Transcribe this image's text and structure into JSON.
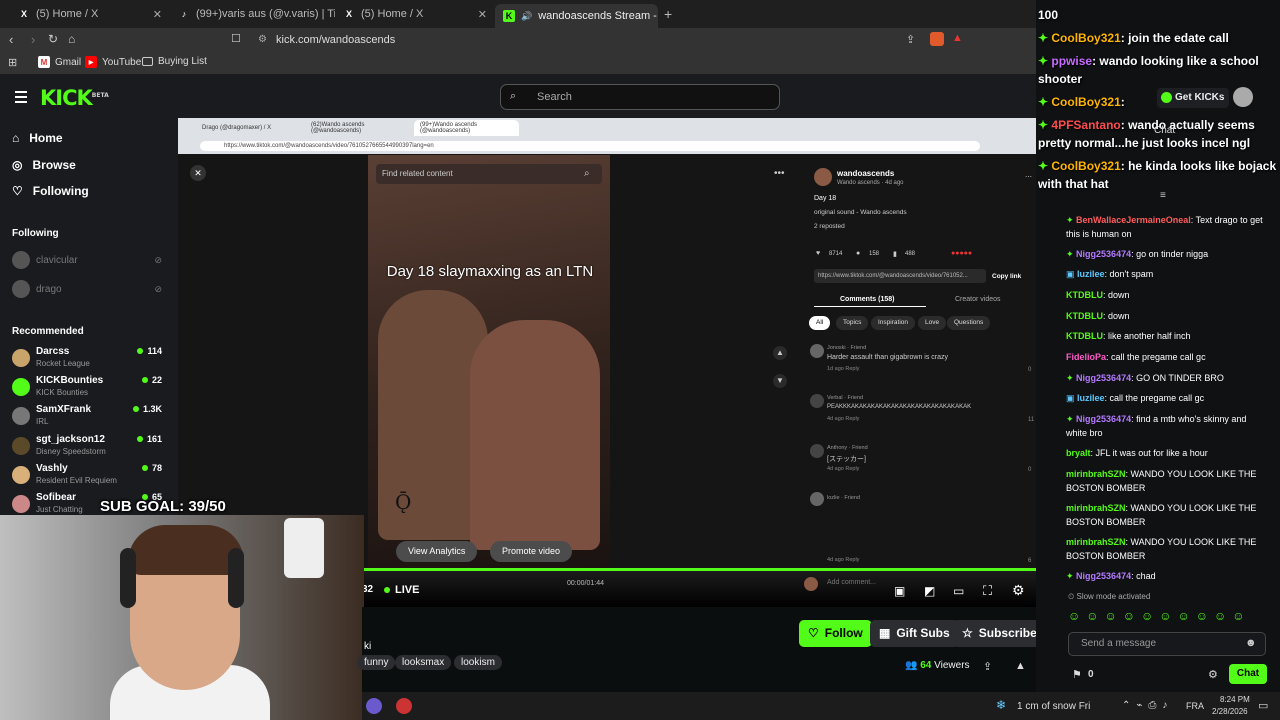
{
  "browser": {
    "tabs": [
      {
        "label": "(5) Home / X",
        "icon": "x-icon"
      },
      {
        "label": "(99+)varis aus (@v.varis) | TikTok",
        "icon": "tiktok-icon"
      },
      {
        "label": "(5) Home / X",
        "icon": "x-icon"
      },
      {
        "label": "wandoascends Stream - Wat",
        "icon": "kick-icon",
        "active": true
      }
    ],
    "url": "kick.com/wandoascends",
    "bookmarks": [
      "Gmail",
      "YouTube",
      "Buying List"
    ]
  },
  "kick": {
    "logo": "KICK",
    "logo_sup": "BETA",
    "search_placeholder": "Search",
    "nav": [
      "Home",
      "Browse",
      "Following"
    ],
    "following_title": "Following",
    "following": [
      "clavicular",
      "drago"
    ],
    "recommended_title": "Recommended",
    "recommended": [
      {
        "name": "Darcss",
        "category": "Rocket League",
        "viewers": "114"
      },
      {
        "name": "KICKBounties",
        "category": "KICK Bounties",
        "viewers": "22"
      },
      {
        "name": "SamXFrank",
        "category": "IRL",
        "viewers": "1.3K"
      },
      {
        "name": "sgt_jackson12",
        "category": "Disney Speedstorm",
        "viewers": "161"
      },
      {
        "name": "Vashly",
        "category": "Resident Evil Requiem",
        "viewers": "78"
      },
      {
        "name": "Sofibear",
        "category": "Just Chatting",
        "viewers": "65"
      }
    ]
  },
  "inner_browser": {
    "tabs": [
      "Drago (@dragomaxer) / X",
      "(62)Wando ascends (@wandoascends)",
      "(99+)Wando ascends (@wandoascends)"
    ],
    "url": "https://www.tiktok.com/@wandoascends/video/7610527665544990397lang=en"
  },
  "tiktok": {
    "find_related": "Find related content",
    "caption": "Day 18 slaymaxxing as an LTN",
    "watermark": "Ǭ",
    "view_analytics": "View Analytics",
    "promote_video": "Promote video",
    "time": "00:00/01:44",
    "author": "wandoascends",
    "author_sub": "Wando ascends · 4d ago",
    "post_title": "Day 18",
    "sound": "original sound - Wando ascends",
    "reposted": "2 reposted",
    "likes": "8714",
    "comments_count": "158",
    "saves": "488",
    "link": "https://www.tiktok.com/@wandoascends/video/761052...",
    "copy_link": "Copy link",
    "comments_tab": "Comments (158)",
    "creator_videos_tab": "Creator videos",
    "chips": [
      "All",
      "Topics",
      "Inspiration",
      "Love",
      "Questions"
    ],
    "comments": [
      {
        "user": "Jonoski · Friend",
        "text": "Harder assault than gigabrown is crazy",
        "meta": "1d ago   Reply",
        "likes": "0"
      },
      {
        "user": "Verbal · Friend",
        "text": "PEAKKKAKAKAKAKAKAKAKAKAKAKAKAKAKAKAK",
        "meta": "4d ago   Reply",
        "likes": "11"
      },
      {
        "user": "Anthony · Friend",
        "text": "[ステッカー]",
        "meta": "4d ago   Reply",
        "likes": "0"
      },
      {
        "user": "lozlie · Friend",
        "text": "",
        "meta": "4d ago   Reply",
        "likes": "6"
      }
    ],
    "add_comment": "Add comment..."
  },
  "player": {
    "live": "LIVE",
    "left_num": "32"
  },
  "webcam": {
    "sub_goal": "SUB GOAL: 39/50"
  },
  "stream_info": {
    "name_fragment": "ki",
    "tags": [
      "funny",
      "looksmax",
      "lookism"
    ],
    "follow": "Follow",
    "gift_subs": "Gift Subs",
    "subscribe": "Subscribe",
    "viewers": "64",
    "viewers_label": "Viewers"
  },
  "chat_overlay": [
    {
      "user": "",
      "text": "100",
      "prefix": ""
    },
    {
      "user": "CoolBoy321",
      "text": ": join the edate call"
    },
    {
      "user": "ppwise",
      "text": ": wando looking like a school shooter"
    },
    {
      "user": "CoolBoy321",
      "text": ":"
    },
    {
      "user": "4PFSantano",
      "text": ": wando actually seems pretty normal...he just looks incel ngl"
    },
    {
      "user": "CoolBoy321",
      "text": ": he kinda looks like bojack with that hat"
    }
  ],
  "chat": {
    "get_kicks": "Get KICKs",
    "header": "Chat",
    "messages": [
      {
        "user": "BenWallaceJermaineOneal",
        "text": ": Text drago to get this is human on",
        "color": "#ff5c5c"
      },
      {
        "user": "Nigg2536474",
        "text": ": go on tinder nigga",
        "color": "#b47aff"
      },
      {
        "user": "luzilee",
        "text": ": don't spam",
        "color": "#5cc8ff"
      },
      {
        "user": "KTDBLU",
        "text": ": down",
        "color": "#53fc18"
      },
      {
        "user": "KTDBLU",
        "text": ": down",
        "color": "#53fc18"
      },
      {
        "user": "KTDBLU",
        "text": ": like another half inch",
        "color": "#53fc18"
      },
      {
        "user": "FidelioPa",
        "text": ": call the pregame call gc",
        "color": "#ff5cc8"
      },
      {
        "user": "Nigg2536474",
        "text": ": GO ON TINDER BRO",
        "color": "#b47aff"
      },
      {
        "user": "luzilee",
        "text": ": call the pregame call gc",
        "color": "#5cc8ff"
      },
      {
        "user": "Nigg2536474",
        "text": ": find a mtb who's skinny and white bro",
        "color": "#b47aff"
      },
      {
        "user": "bryalt",
        "text": ": JFL it was out for like a hour",
        "color": "#53fc18"
      },
      {
        "user": "mirinbrahSZN",
        "text": ": WANDO YOU LOOK LIKE THE BOSTON BOMBER",
        "color": "#53fc18"
      },
      {
        "user": "mirinbrahSZN",
        "text": ": WANDO YOU LOOK LIKE THE BOSTON BOMBER",
        "color": "#53fc18"
      },
      {
        "user": "mirinbrahSZN",
        "text": ": WANDO YOU LOOK LIKE THE BOSTON BOMBER",
        "color": "#53fc18"
      },
      {
        "user": "Nigg2536474",
        "text": ": chad",
        "color": "#b47aff"
      }
    ],
    "slow_mode": "Slow mode activated",
    "send_placeholder": "Send a message",
    "kicks_count": "0",
    "chat_button": "Chat"
  },
  "taskbar": {
    "weather": "1 cm of snow Fri",
    "lang": "FRA",
    "time": "8:24 PM",
    "date": "2/28/2026"
  },
  "colors": {
    "accent": "#53fc18",
    "bg": "#0b0e0f",
    "sidebar": "#191b1f"
  }
}
